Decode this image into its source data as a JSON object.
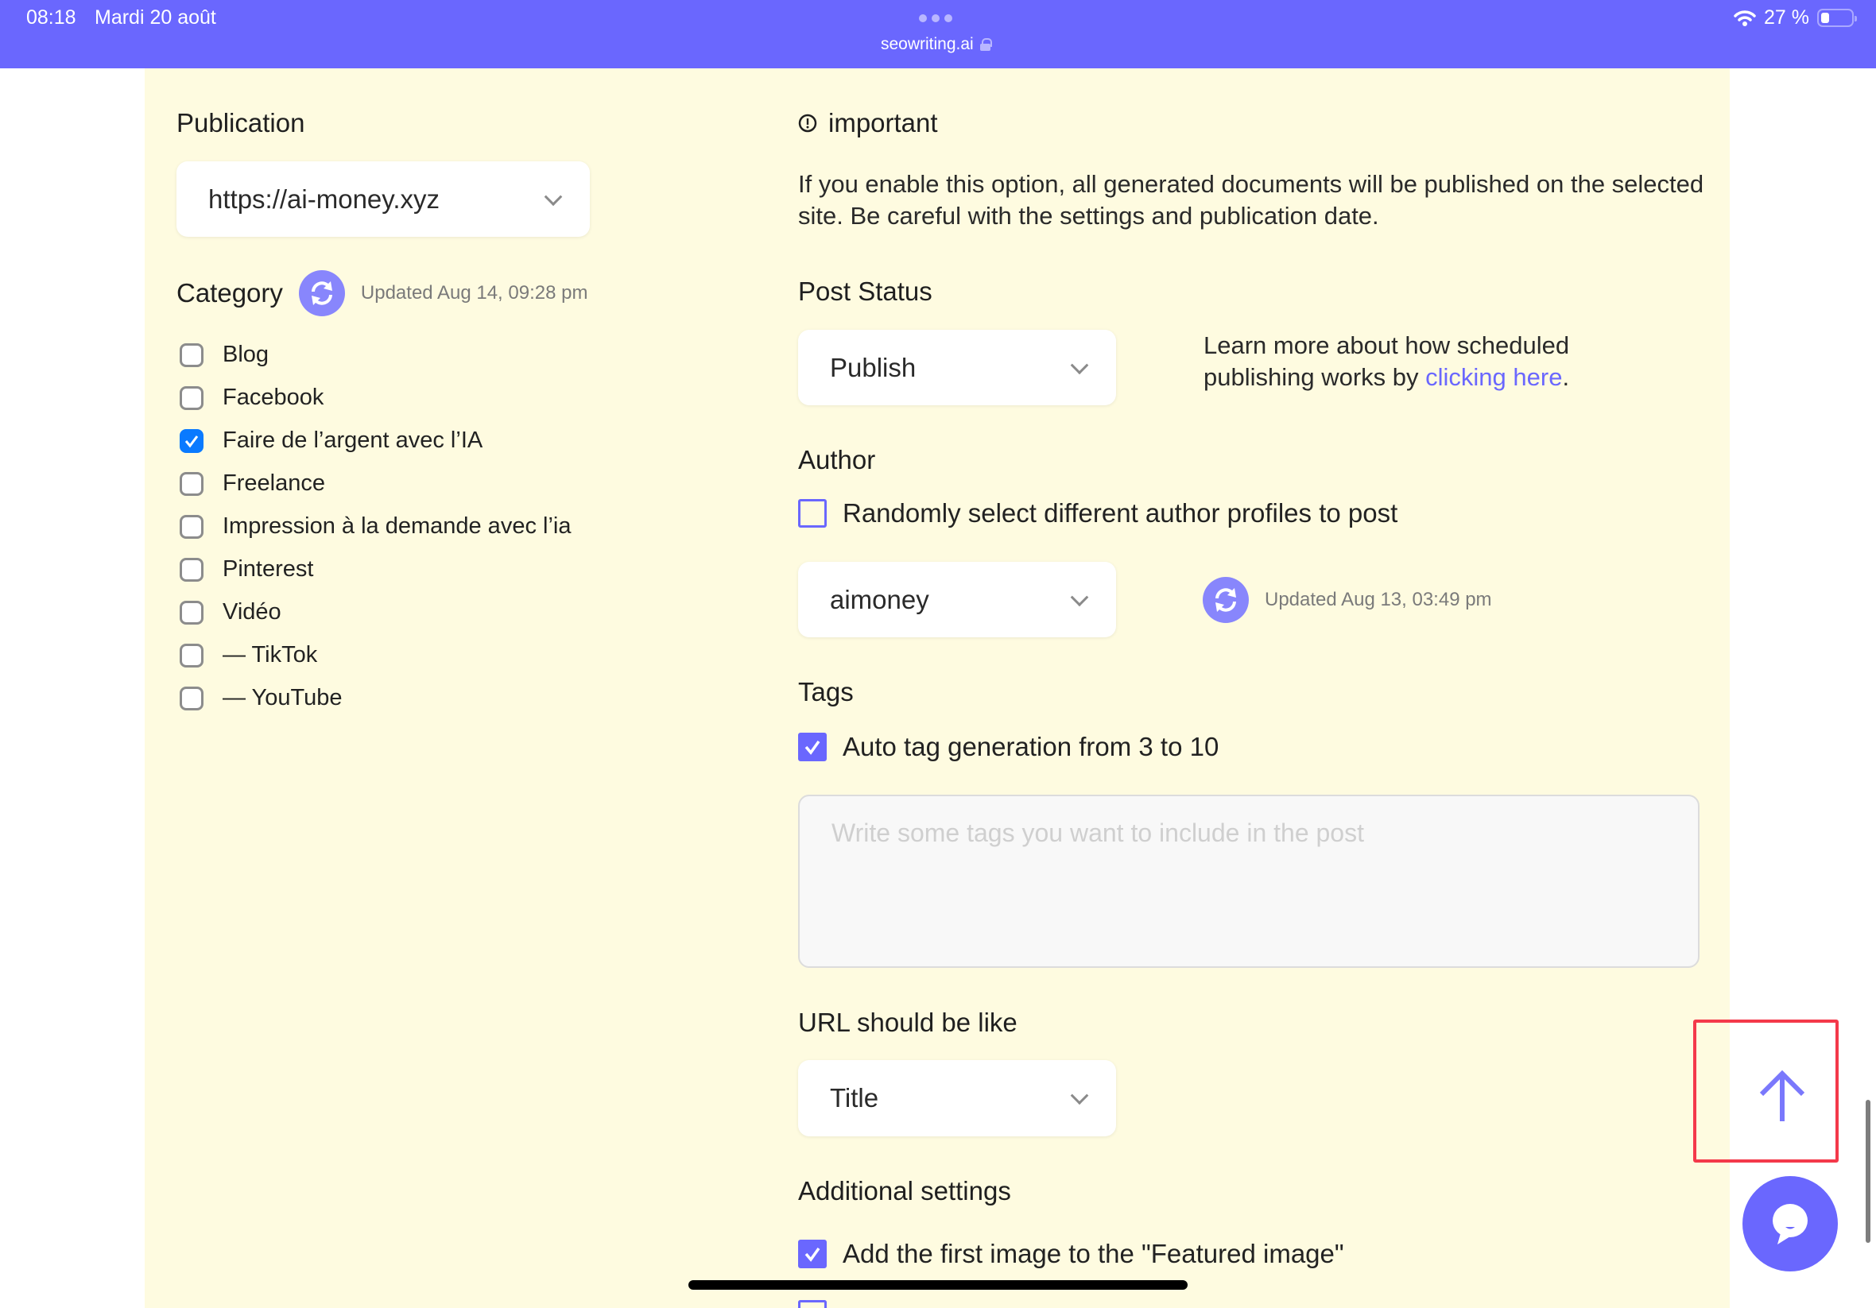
{
  "status_bar": {
    "time": "08:18",
    "date": "Mardi 20 août",
    "url": "seowriting.ai",
    "battery_percent_label": "27 %",
    "battery_level": 0.27,
    "accent": "#6A67FE"
  },
  "publication": {
    "label": "Publication",
    "selected": "https://ai-money.xyz"
  },
  "category": {
    "label": "Category",
    "updated": "Updated Aug 14, 09:28 pm",
    "items": [
      {
        "label": "Blog",
        "checked": false
      },
      {
        "label": "Facebook",
        "checked": false
      },
      {
        "label": "Faire de l’argent avec l’IA",
        "checked": true
      },
      {
        "label": "Freelance",
        "checked": false
      },
      {
        "label": "Impression à la demande avec l’ia",
        "checked": false
      },
      {
        "label": "Pinterest",
        "checked": false
      },
      {
        "label": "Vidéo",
        "checked": false
      },
      {
        "label": "— TikTok",
        "checked": false
      },
      {
        "label": "— YouTube",
        "checked": false
      }
    ]
  },
  "important": {
    "title": "important",
    "text": "If you enable this option, all generated documents will be published on the selected site. Be careful with the settings and publication date."
  },
  "post_status": {
    "label": "Post Status",
    "selected": "Publish",
    "learn_more_prefix": "Learn more about how scheduled publishing works by ",
    "learn_more_link": "clicking here",
    "learn_more_suffix": "."
  },
  "author": {
    "label": "Author",
    "random_label": "Randomly select different author profiles to post",
    "random_checked": false,
    "selected": "aimoney",
    "updated": "Updated Aug 13, 03:49 pm"
  },
  "tags": {
    "label": "Tags",
    "auto_label": "Auto tag generation from 3 to 10",
    "auto_checked": true,
    "placeholder": "Write some tags you want to include in the post",
    "value": ""
  },
  "url_setting": {
    "label": "URL should be like",
    "selected": "Title"
  },
  "additional": {
    "label": "Additional settings",
    "featured_label": "Add the first image to the \"Featured image\"",
    "featured_checked": true
  }
}
